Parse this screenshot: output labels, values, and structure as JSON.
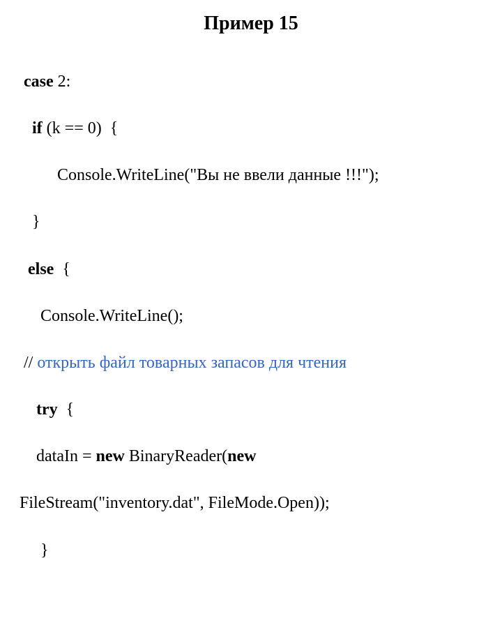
{
  "title": "Пример 15",
  "code": {
    "l1": {
      "kw": "case",
      "rest": " 2:"
    },
    "l2": {
      "indent": "   ",
      "kw": "if",
      "rest": " (k == 0)  {"
    },
    "l3": "         Console.WriteLine(\"Вы не ввели данные !!!\");",
    "l4": "   }",
    "l5": {
      "indent": "  ",
      "kw": "else",
      "rest": "  {"
    },
    "l6": "     Console.WriteLine();",
    "l7": {
      "slashes": " // ",
      "text": "открыть файл товарных запасов для чтения"
    },
    "l8": {
      "indent": "    ",
      "kw": "try",
      "rest": "  {"
    },
    "l9": {
      "before": "    dataIn = ",
      "kw1": "new",
      "mid": " BinaryReader(",
      "kw2": "new",
      "after": ""
    },
    "l10": "FileStream(\"inventory.dat\", FileMode.Open));",
    "l11": "     }"
  }
}
